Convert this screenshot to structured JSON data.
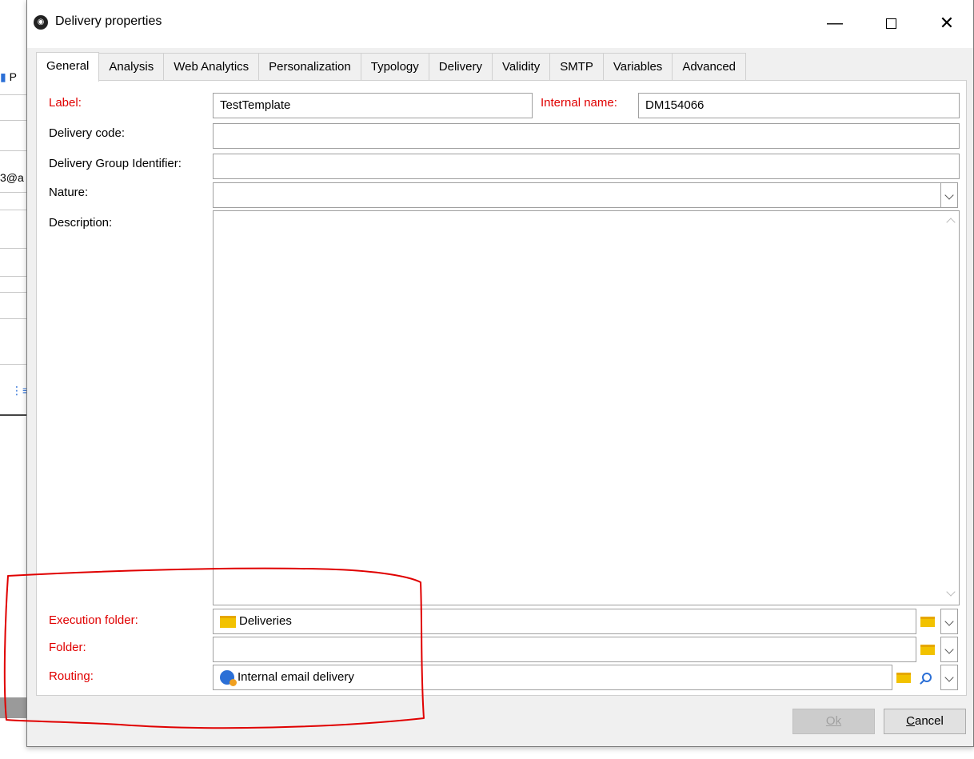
{
  "background": {
    "partial_text_1": "P",
    "partial_text_2": "3@a"
  },
  "window": {
    "title": "Delivery properties",
    "minimize_glyph": "—",
    "close_glyph": "✕"
  },
  "tabs": [
    {
      "label": "General",
      "active": true
    },
    {
      "label": "Analysis"
    },
    {
      "label": "Web Analytics"
    },
    {
      "label": "Personalization"
    },
    {
      "label": "Typology"
    },
    {
      "label": "Delivery"
    },
    {
      "label": "Validity"
    },
    {
      "label": "SMTP"
    },
    {
      "label": "Variables"
    },
    {
      "label": "Advanced"
    }
  ],
  "form": {
    "label_label": "Label:",
    "label_value": "TestTemplate",
    "internal_name_label": "Internal name:",
    "internal_name_value": "DM154066",
    "delivery_code_label": "Delivery code:",
    "delivery_code_value": "",
    "group_id_label": "Delivery Group Identifier:",
    "group_id_value": "",
    "nature_label": "Nature:",
    "nature_value": "",
    "description_label": "Description:",
    "execution_folder_label": "Execution folder:",
    "execution_folder_value": "Deliveries",
    "folder_label": "Folder:",
    "folder_value": "",
    "routing_label": "Routing:",
    "routing_value": "Internal email delivery"
  },
  "buttons": {
    "ok": "Ok",
    "cancel_prefix": "C",
    "cancel_rest": "ancel"
  },
  "colors": {
    "required_label": "#e00000",
    "annotation": "#e00000"
  }
}
